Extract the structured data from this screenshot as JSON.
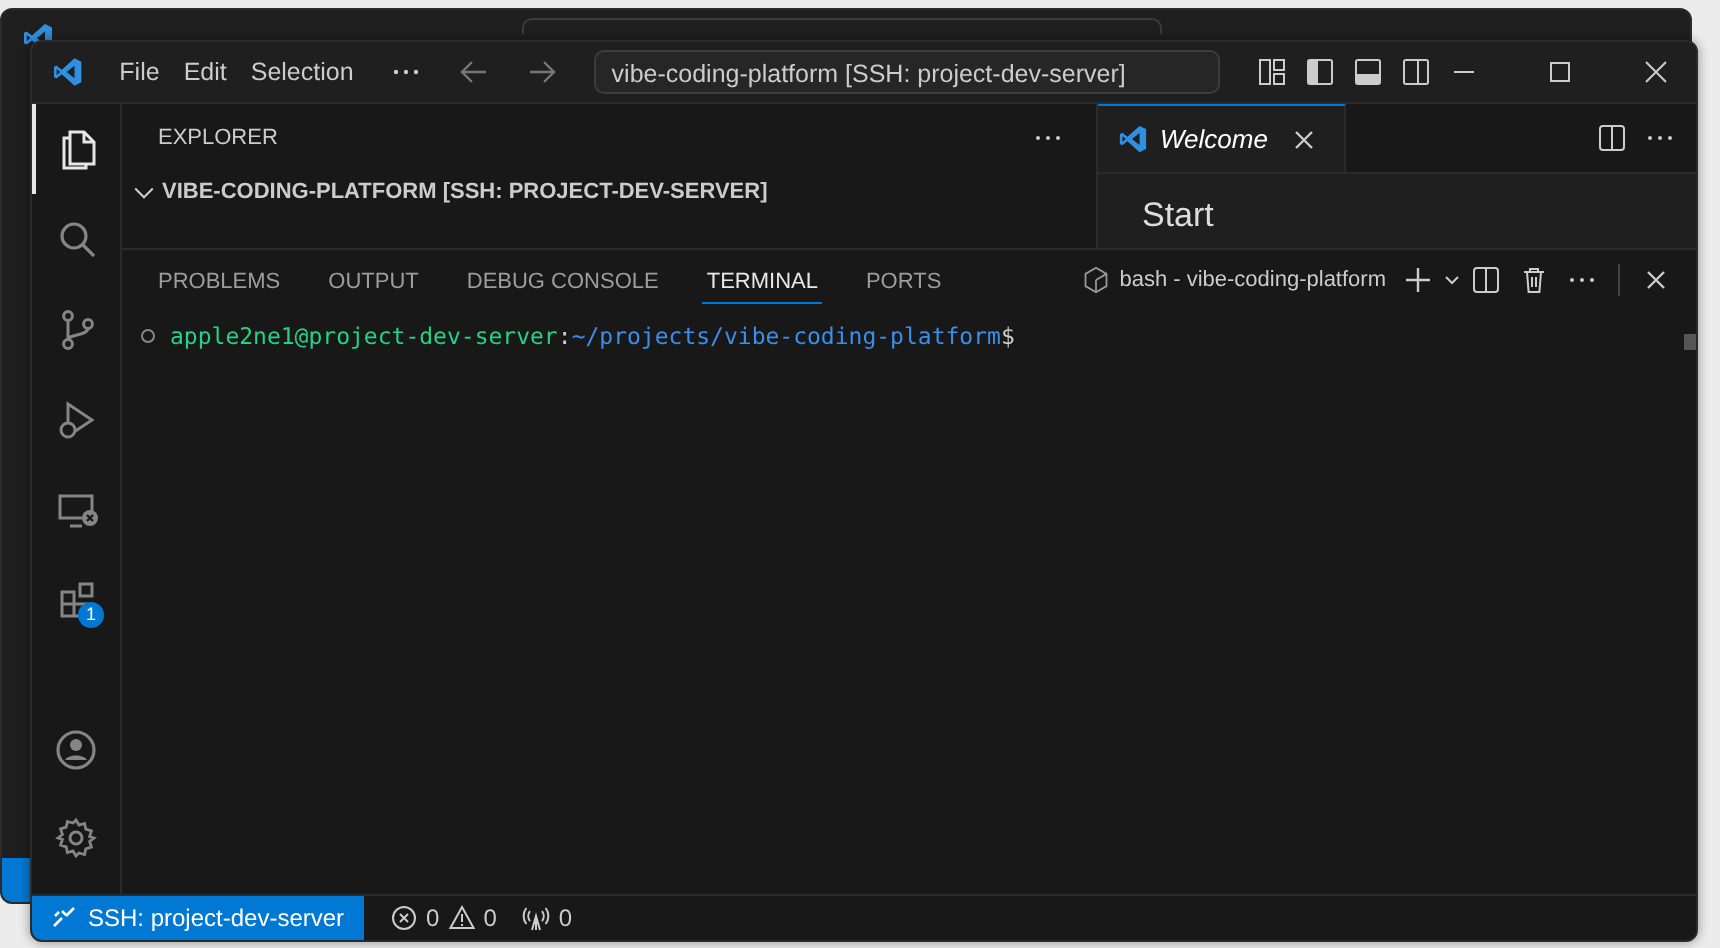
{
  "window": {
    "menu": [
      "File",
      "Edit",
      "Selection"
    ],
    "search": "vibe-coding-platform [SSH: project-dev-server]"
  },
  "activity_bar": {
    "items": [
      {
        "kind": "explorer",
        "selected": true
      },
      {
        "kind": "search",
        "selected": false
      },
      {
        "kind": "source-control",
        "selected": false
      },
      {
        "kind": "run-debug",
        "selected": false
      },
      {
        "kind": "remote",
        "selected": false
      },
      {
        "kind": "extensions",
        "selected": false,
        "badge": "1"
      }
    ],
    "bottom": [
      {
        "kind": "account"
      },
      {
        "kind": "settings"
      }
    ]
  },
  "sidebar": {
    "title": "EXPLORER",
    "folder": {
      "label": "VIBE-CODING-PLATFORM [SSH: PROJECT-DEV-SERVER]",
      "expanded": true
    }
  },
  "editor": {
    "tabs": [
      {
        "label": "Welcome",
        "selected": true
      }
    ],
    "heading": "Start"
  },
  "panel": {
    "tabs": [
      {
        "label": "PROBLEMS",
        "selected": false
      },
      {
        "label": "OUTPUT",
        "selected": false
      },
      {
        "label": "DEBUG CONSOLE",
        "selected": false
      },
      {
        "label": "TERMINAL",
        "selected": true
      },
      {
        "label": "PORTS",
        "selected": false
      }
    ],
    "terminal_name": "bash - vibe-coding-platform",
    "prompt": {
      "user": "apple2ne1@project-dev-server",
      "separator": ":",
      "path": "~/projects/vibe-coding-platform",
      "symbol": "$"
    }
  },
  "status_bar": {
    "remote": "SSH: project-dev-server",
    "errors": "0",
    "warnings": "0",
    "ports": "0"
  }
}
